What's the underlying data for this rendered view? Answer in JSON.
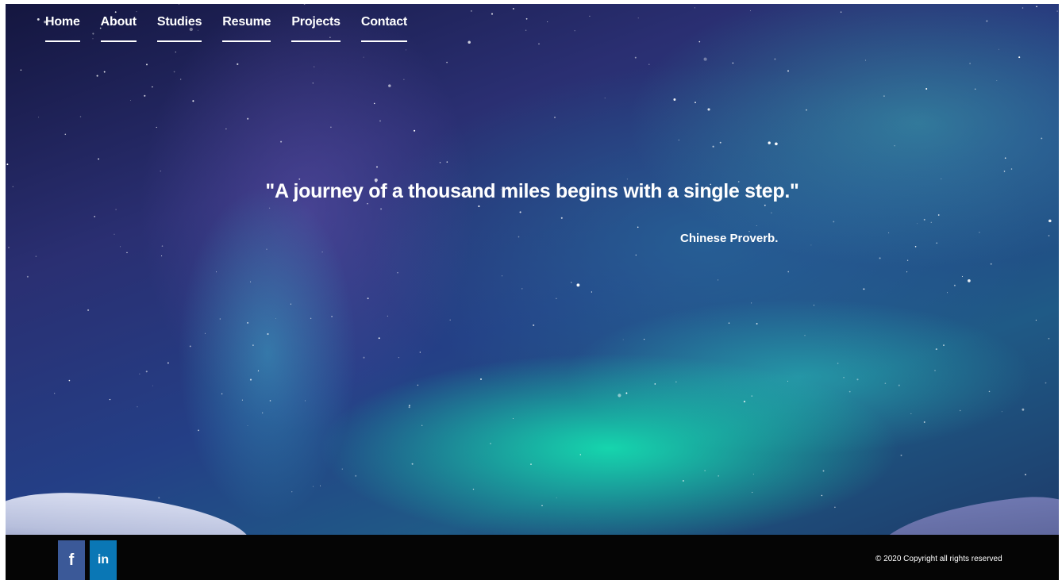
{
  "nav": {
    "items": [
      {
        "label": "Home"
      },
      {
        "label": "About"
      },
      {
        "label": "Studies"
      },
      {
        "label": "Resume"
      },
      {
        "label": "Projects"
      },
      {
        "label": "Contact"
      }
    ]
  },
  "hero": {
    "quote": "\"A journey of a thousand miles begins with a single step.\"",
    "author": "Chinese Proverb."
  },
  "footer": {
    "social": [
      {
        "icon": "facebook-icon",
        "glyph": "f",
        "color": "#3b5998"
      },
      {
        "icon": "linkedin-icon",
        "glyph": "in",
        "color": "#0a77b5"
      }
    ],
    "copyright": "© 2020 Copyright all rights reserved"
  },
  "colors": {
    "text": "#ffffff",
    "footer_bg": "#050505"
  }
}
